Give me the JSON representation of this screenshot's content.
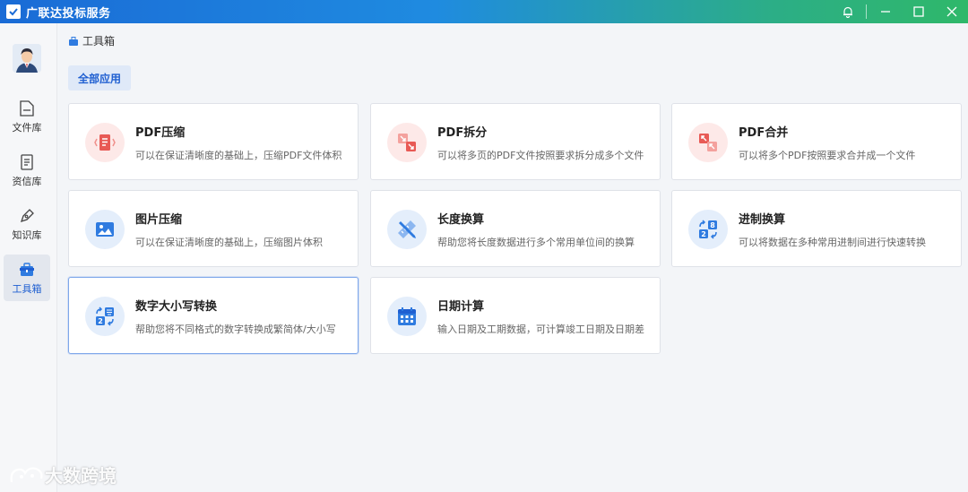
{
  "window": {
    "title": "广联达投标服务"
  },
  "sidebar": {
    "items": [
      {
        "label": "文件库",
        "icon": "folder-icon"
      },
      {
        "label": "资信库",
        "icon": "document-icon"
      },
      {
        "label": "知识库",
        "icon": "pen-icon"
      },
      {
        "label": "工具箱",
        "icon": "toolbox-icon",
        "active": true
      }
    ]
  },
  "main": {
    "breadcrumb": "工具箱",
    "filter_tab": "全部应用",
    "cards": [
      {
        "title": "PDF压缩",
        "desc": "可以在保证清晰度的基础上，压缩PDF文件体积",
        "icon": "pdf-compress-icon"
      },
      {
        "title": "PDF拆分",
        "desc": "可以将多页的PDF文件按照要求拆分成多个文件",
        "icon": "pdf-split-icon"
      },
      {
        "title": "PDF合并",
        "desc": "可以将多个PDF按照要求合并成一个文件",
        "icon": "pdf-merge-icon"
      },
      {
        "title": "图片压缩",
        "desc": "可以在保证清晰度的基础上，压缩图片体积",
        "icon": "image-compress-icon"
      },
      {
        "title": "长度换算",
        "desc": "帮助您将长度数据进行多个常用单位间的换算",
        "icon": "ruler-pencil-icon"
      },
      {
        "title": "进制换算",
        "desc": "可以将数据在多种常用进制间进行快速转换",
        "icon": "number-convert-icon"
      },
      {
        "title": "数字大小写转换",
        "desc": "帮助您将不同格式的数字转换成繁简体/大小写",
        "icon": "digit-case-icon"
      },
      {
        "title": "日期计算",
        "desc": "输入日期及工期数据，可计算竣工日期及日期差",
        "icon": "calendar-icon"
      }
    ]
  },
  "watermark": "大数跨境",
  "colors": {
    "accent": "#1f5fd1",
    "red_icon": "#e85a55",
    "blue_icon": "#2f7be0"
  }
}
